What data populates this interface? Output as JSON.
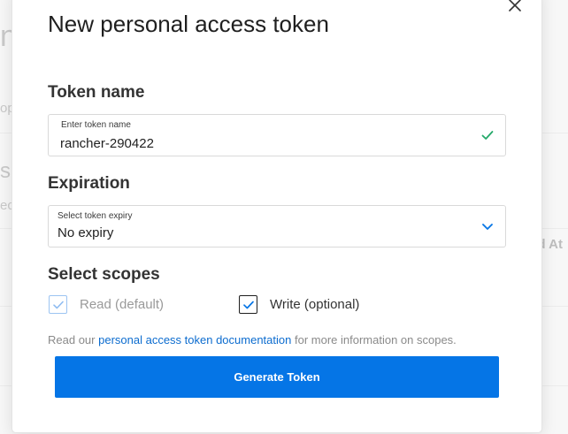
{
  "background": {
    "fragment_title": "ns",
    "fragment_small_1": "op",
    "fragment_heading_2": "s",
    "fragment_small_2": "ec",
    "fragment_column": "d At"
  },
  "modal": {
    "title": "New personal access token",
    "close_icon": "close-icon"
  },
  "token_name": {
    "section_label": "Token name",
    "field_label": "Enter token name",
    "value": "rancher-290422",
    "valid_icon": "check-icon"
  },
  "expiration": {
    "section_label": "Expiration",
    "field_label": "Select token expiry",
    "selected": "No expiry",
    "icon": "chevron-down-icon"
  },
  "scopes": {
    "section_label": "Select scopes",
    "read_label": "Read (default)",
    "read_checked": true,
    "read_disabled": true,
    "write_label": "Write (optional)",
    "write_checked": true
  },
  "help": {
    "prefix": "Read our",
    "link_text": "personal access token documentation",
    "suffix": "for more information on scopes."
  },
  "actions": {
    "generate_label": "Generate Token"
  },
  "colors": {
    "primary": "#0575e6",
    "link": "#0c6ccf",
    "success_check": "#25a96a",
    "disabled_check": "#8fbcf1",
    "active_check": "#0575e6"
  }
}
